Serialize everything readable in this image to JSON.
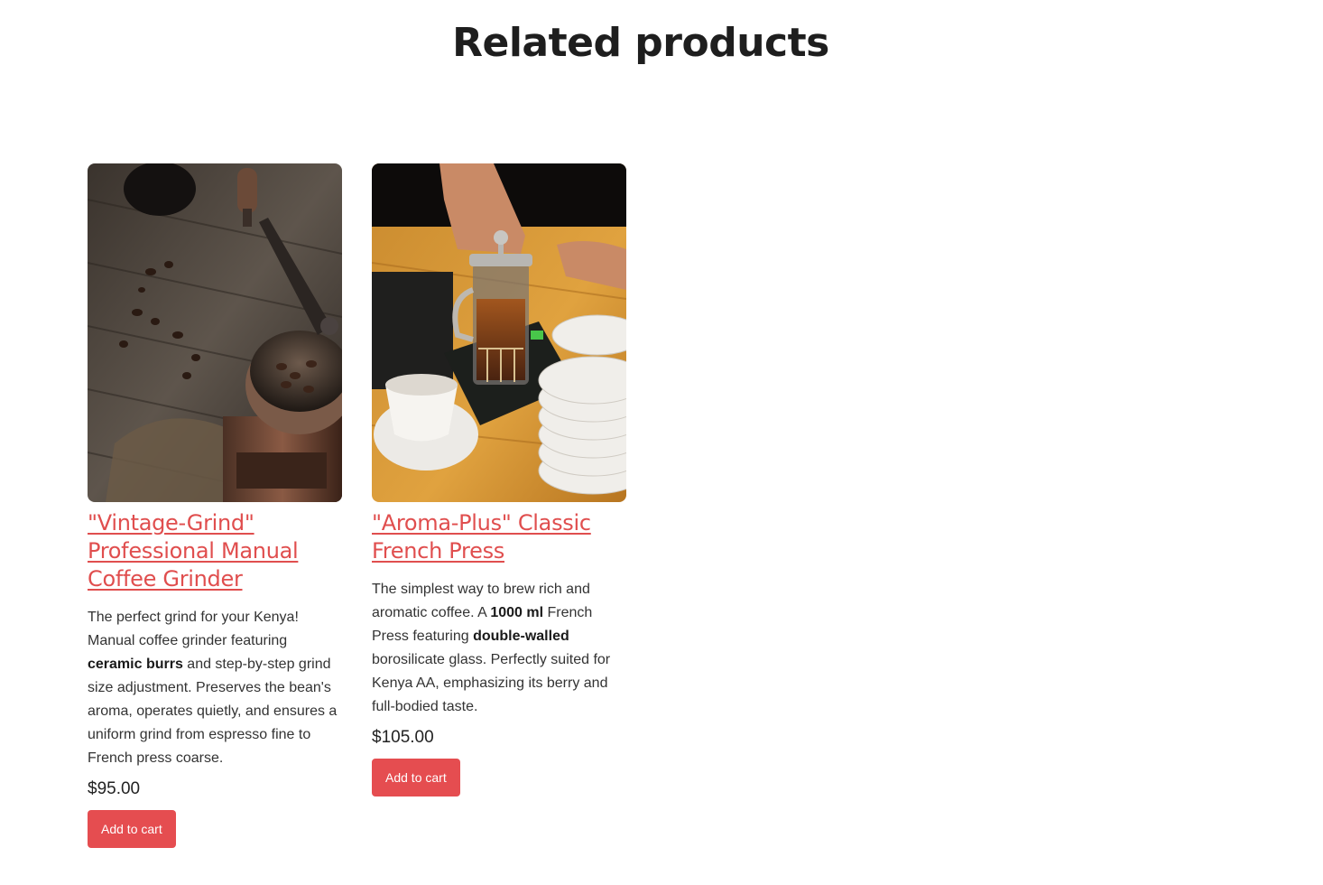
{
  "section": {
    "title": "Related products"
  },
  "products": [
    {
      "title": "\"Vintage-Grind\" Professional Manual Coffee Grinder",
      "image": "manual-coffee-grinder-photo",
      "desc": {
        "p1": "The perfect grind for your Kenya! Manual coffee grinder featuring ",
        "b1": "ceramic burrs",
        "p2": " and step-by-step grind size adjustment. Preserves the bean's aroma, operates quietly, and ensures a uniform grind from espresso fine to French press coarse."
      },
      "price": "$95.00",
      "button": "Add to cart"
    },
    {
      "title": "\"Aroma-Plus\" Classic French Press",
      "image": "french-press-photo",
      "desc": {
        "p1": "The simplest way to brew rich and aromatic coffee. A ",
        "b1": "1000 ml",
        "p2": " French Press featuring ",
        "b2": "double-walled",
        "p3": " borosilicate glass. Perfectly suited for Kenya AA, emphasizing its berry and full-bodied taste."
      },
      "price": "$105.00",
      "button": "Add to cart"
    }
  ],
  "colors": {
    "accent": "#e54d50",
    "link": "#e04e4e",
    "text": "#333333"
  }
}
